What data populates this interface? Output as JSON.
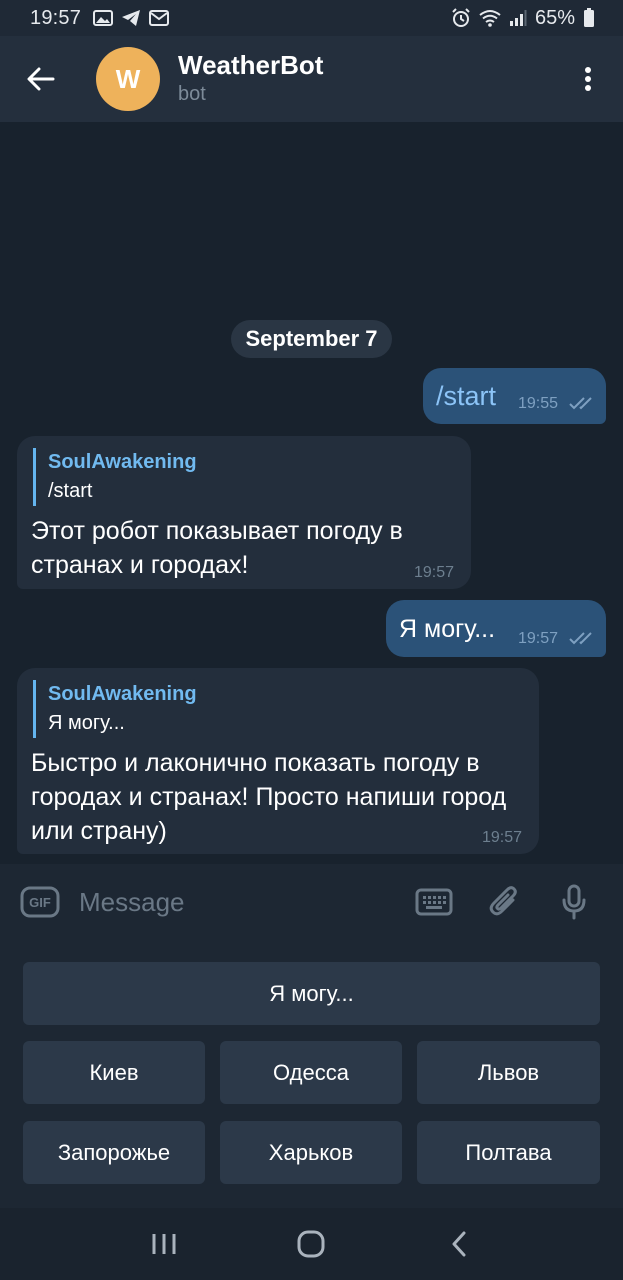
{
  "status_bar": {
    "time": "19:57",
    "battery": "65%",
    "icons": [
      "gallery-icon",
      "telegram-icon",
      "mail-icon",
      "alarm-icon",
      "wifi-icon",
      "signal-icon",
      "battery-icon"
    ]
  },
  "header": {
    "avatar_letter": "W",
    "title": "WeatherBot",
    "subtitle": "bot",
    "avatar_color": "#eeb25b"
  },
  "chat": {
    "date_label": "September 7",
    "messages": [
      {
        "direction": "out",
        "text": "/start",
        "time": "19:55"
      },
      {
        "direction": "in",
        "reply_name": "SoulAwakening",
        "reply_text": "/start",
        "text": "Этот робот показывает погоду в странах и городах!",
        "time": "19:57"
      },
      {
        "direction": "out",
        "text": "Я могу...",
        "time": "19:57"
      },
      {
        "direction": "in",
        "reply_name": "SoulAwakening",
        "reply_text": "Я могу...",
        "text": "Быстро и лаконично показать погоду в городах и странах! Просто напиши город или страну)",
        "time": "19:57"
      }
    ]
  },
  "input": {
    "gif_label": "GIF",
    "placeholder": "Message"
  },
  "keyboard": {
    "rows": [
      [
        "Я могу..."
      ],
      [
        "Киев",
        "Одесса",
        "Львов"
      ],
      [
        "Запорожье",
        "Харьков",
        "Полтава"
      ]
    ]
  },
  "colors": {
    "background": "#18222d",
    "header": "#242f3d",
    "outgoing_bubble": "#2b5278",
    "incoming_bubble": "#232e3c",
    "accent": "#71baf0"
  }
}
